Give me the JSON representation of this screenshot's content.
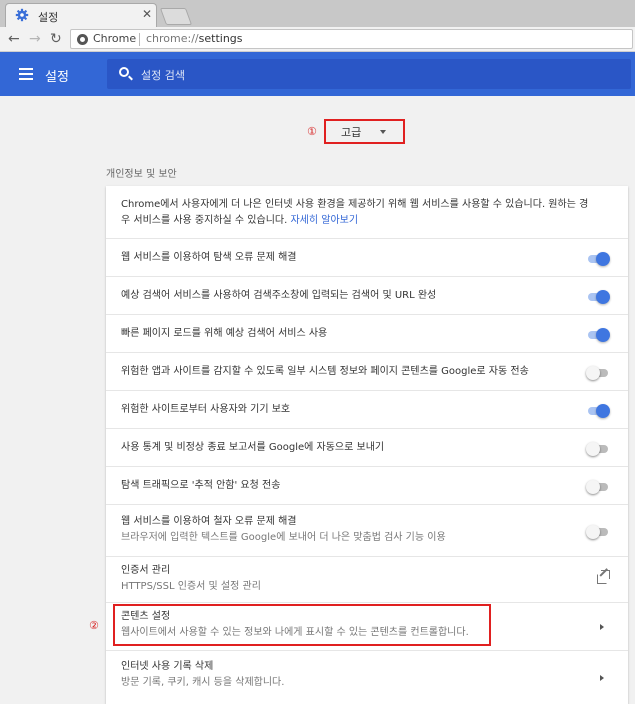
{
  "browser": {
    "tab_title": "설정",
    "tab_close": "✕",
    "site_name": "Chrome",
    "url_scheme": "chrome://",
    "url_path": "settings",
    "back": "←",
    "forward": "→",
    "reload": "↻"
  },
  "header": {
    "title": "설정",
    "search_placeholder": "설정 검색"
  },
  "markers": {
    "one": "①",
    "two": "②"
  },
  "advanced": {
    "label": "고급"
  },
  "privacy": {
    "section_title": "개인정보 및 보안",
    "intro_line1": "Chrome에서 사용자에게 더 나은 인터넷 사용 환경을 제공하기 위해 웹 서비스를 사용할 수 있습니다. 원하는 경",
    "intro_line2": "우 서비스를 사용 중지하실 수 있습니다.",
    "intro_link": "자세히 알아보기",
    "toggles": [
      {
        "label": "웹 서비스를 이용하여 탐색 오류 문제 해결",
        "state": "on"
      },
      {
        "label": "예상 검색어 서비스를 사용하여 검색주소창에 입력되는 검색어 및 URL 완성",
        "state": "on"
      },
      {
        "label": "빠른 페이지 로드를 위해 예상 검색어 서비스 사용",
        "state": "on"
      },
      {
        "label": "위험한 앱과 사이트를 감지할 수 있도록 일부 시스템 정보와 페이지 콘텐츠를 Google로 자동 전송",
        "state": "off"
      },
      {
        "label": "위험한 사이트로부터 사용자와 기기 보호",
        "state": "on"
      },
      {
        "label": "사용 통계 및 비정상 종료 보고서를 Google에 자동으로 보내기",
        "state": "off"
      },
      {
        "label": "탐색 트래픽으로 '추적 안함' 요청 전송",
        "state": "off"
      }
    ],
    "spell": {
      "label": "웹 서비스를 이용하여 철자 오류 문제 해결",
      "sub": "브라우저에 입력한 텍스트를 Google에 보내어 더 나은 맞춤법 검사 기능 이용",
      "state": "off"
    },
    "certs": {
      "label": "인증서 관리",
      "sub": "HTTPS/SSL 인증서 및 설정 관리"
    },
    "content": {
      "label": "콘텐츠 설정",
      "sub": "웹사이트에서 사용할 수 있는 정보와 나에게 표시할 수 있는 콘텐츠를 컨트롤합니다."
    },
    "clear": {
      "label": "인터넷 사용 기록 삭제",
      "sub": "방문 기록, 쿠키, 캐시 등을 삭제합니다."
    }
  },
  "colors": {
    "accent": "#3367d6",
    "highlight": "#e02020"
  }
}
